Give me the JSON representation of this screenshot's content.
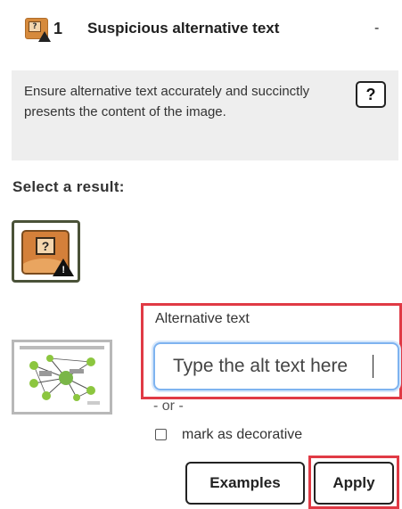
{
  "issue": {
    "icon": "suspicious-alt-text-icon",
    "count": "1",
    "title": "Suspicious alternative text",
    "trailing": "-"
  },
  "description": {
    "text": "Ensure alternative text accurately and succinctly presents the content of the image.",
    "help_label": "?"
  },
  "select_heading": "Select a result:",
  "result_option": {
    "icon": "suspicious-alt-text-icon",
    "glyph": "?"
  },
  "thumbnail": {
    "icon": "image-thumbnail"
  },
  "alt_text": {
    "label": "Alternative text",
    "placeholder": "Type the alt text here",
    "value": ""
  },
  "or_text": "- or -",
  "decorative": {
    "label": "mark as decorative",
    "checked": false
  },
  "buttons": {
    "examples_label": "Examples",
    "apply_label": "Apply"
  },
  "colors": {
    "highlight": "#e03a45",
    "input_focus": "#7eb3f0",
    "description_bg": "#eeeeee",
    "icon_orange": "#d4803a"
  }
}
